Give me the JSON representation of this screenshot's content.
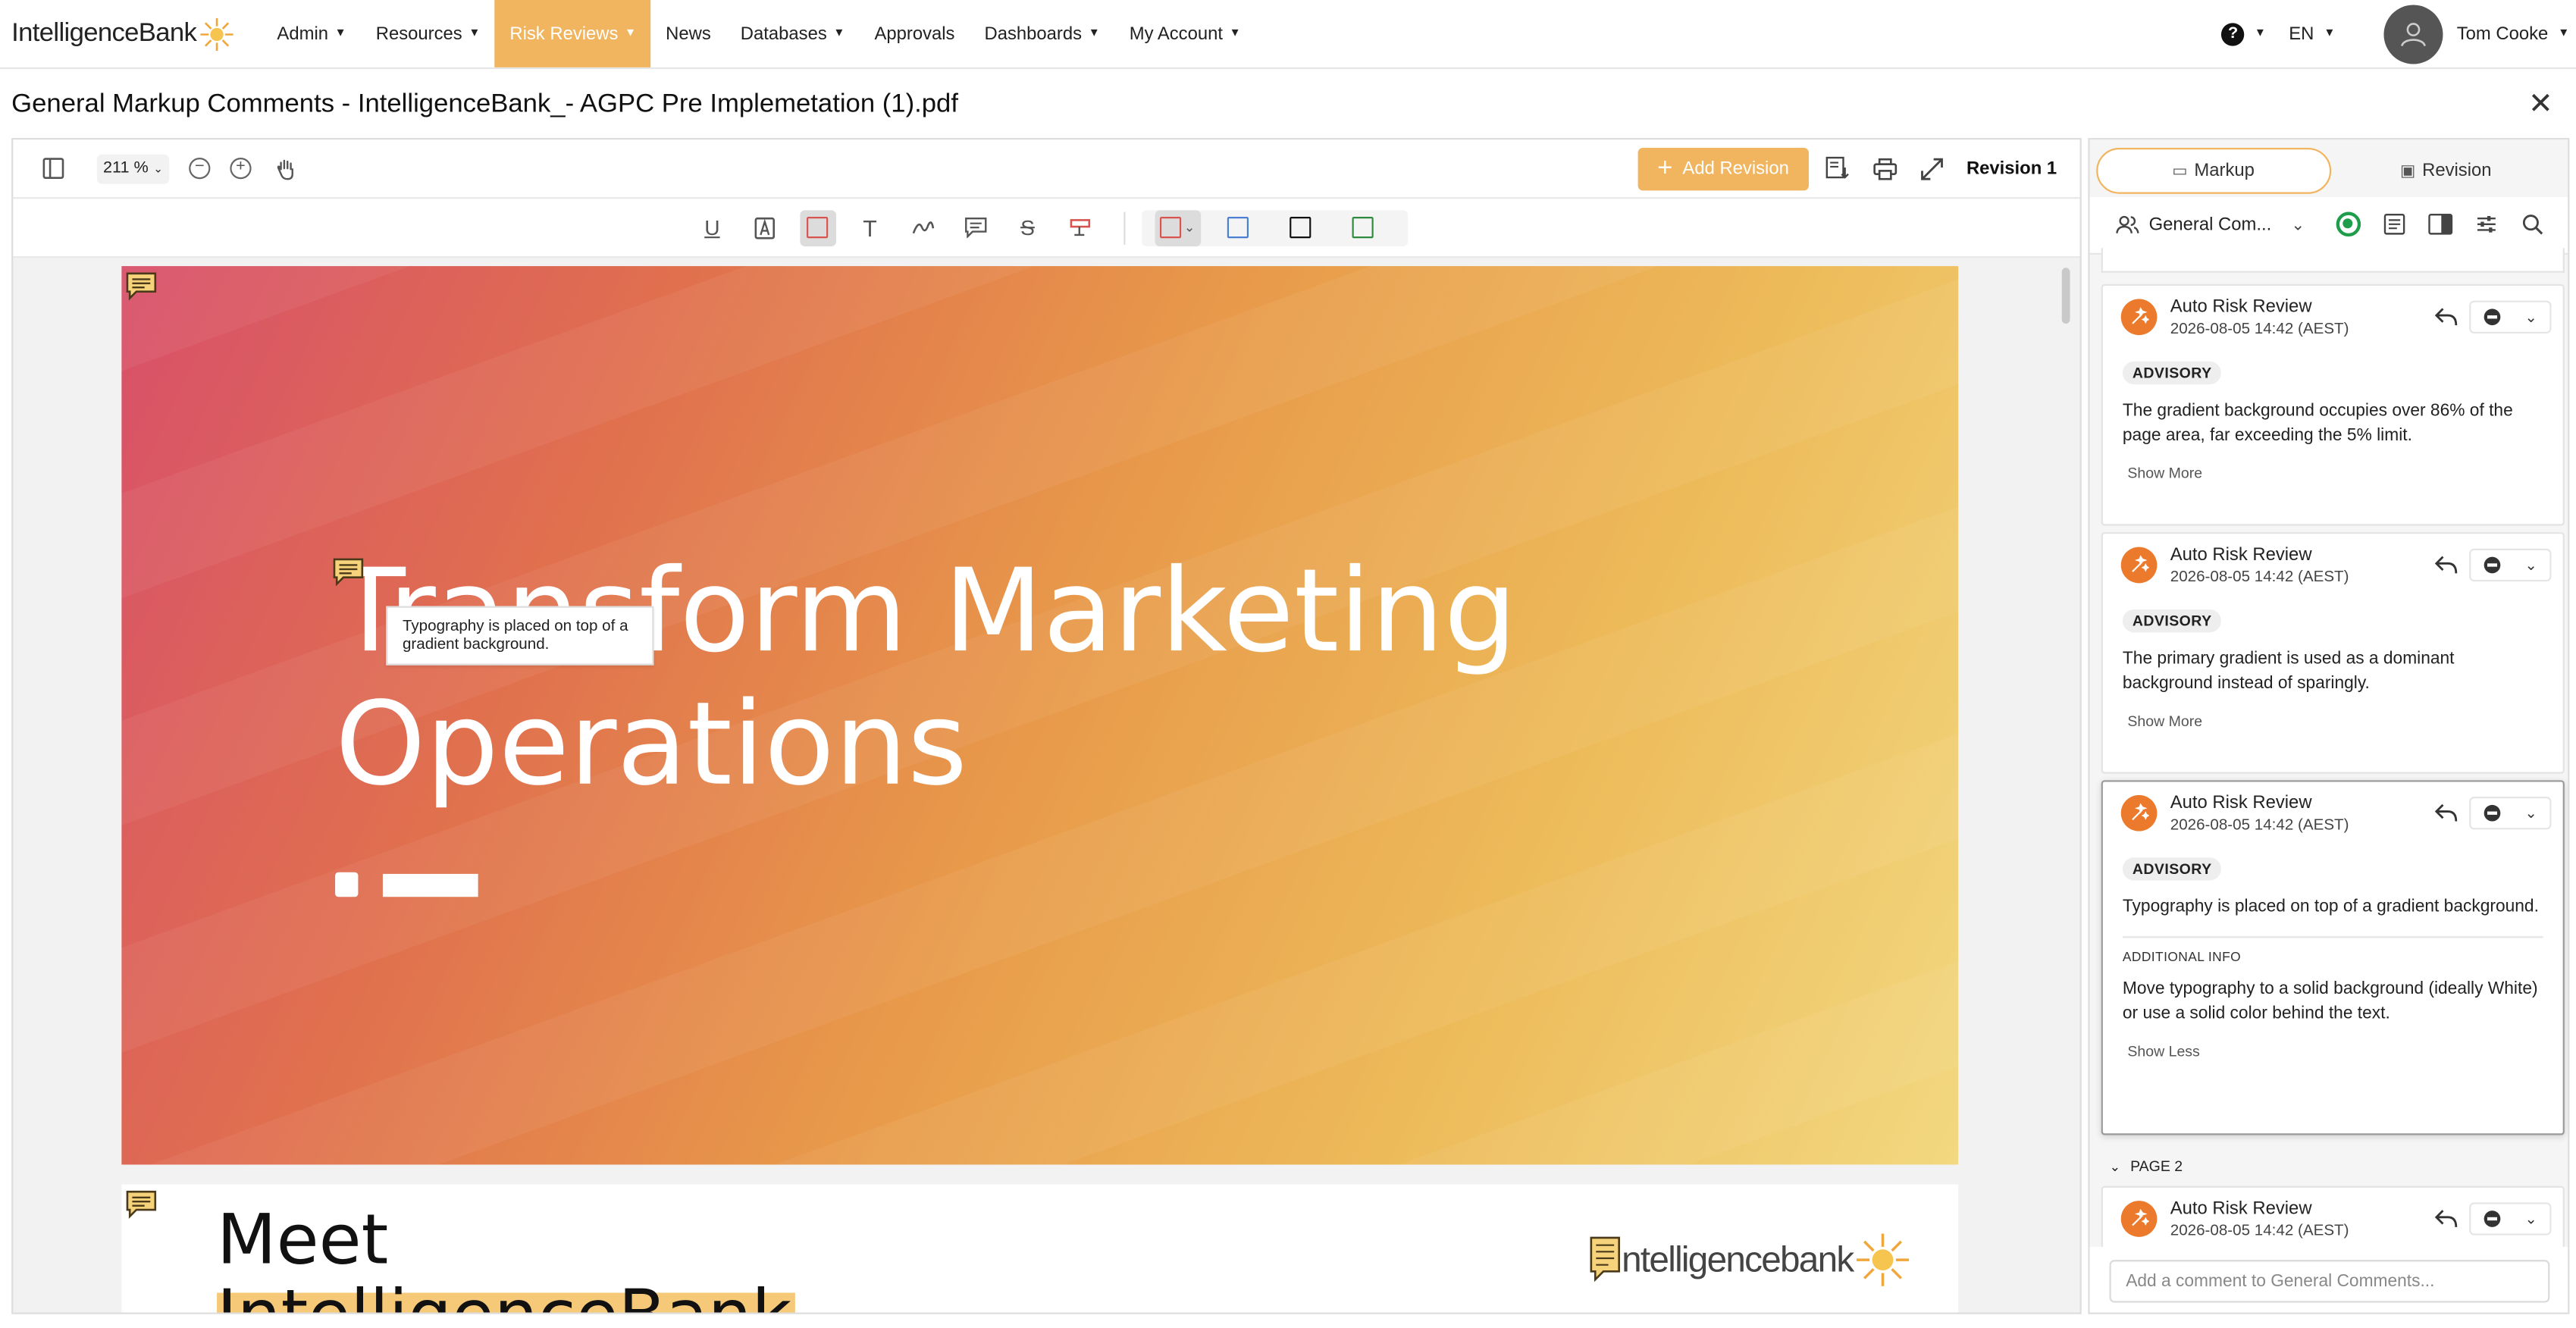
{
  "nav": {
    "logo": "IntelligenceBank",
    "items": [
      {
        "label": "Admin",
        "caret": true
      },
      {
        "label": "Resources",
        "caret": true
      },
      {
        "label": "Risk Reviews",
        "caret": true,
        "active": true
      },
      {
        "label": "News",
        "caret": false
      },
      {
        "label": "Databases",
        "caret": true
      },
      {
        "label": "Approvals",
        "caret": false
      },
      {
        "label": "Dashboards",
        "caret": true
      },
      {
        "label": "My Account",
        "caret": true
      }
    ],
    "help_icon": "?",
    "language": "EN",
    "user_name": "Tom Cooke"
  },
  "document": {
    "title": "General Markup Comments - IntelligenceBank_- AGPC Pre Implemetation (1).pdf"
  },
  "viewer": {
    "zoom": "211 %",
    "add_revision_label": "Add Revision",
    "revision_label": "Revision 1"
  },
  "page1": {
    "headline_line1": "Transform Marketing",
    "headline_line2": "Operations",
    "tooltip_text": "Typography is placed on top of a gradient background."
  },
  "page2": {
    "heading_line1": "Meet",
    "heading_line2": "IntelligenceBank",
    "logo_text": "ntelligencebank"
  },
  "panel": {
    "tabs": [
      {
        "label": "Markup",
        "active": true
      },
      {
        "label": "Revision",
        "active": false
      }
    ],
    "filter_label": "General Com...",
    "page_group_label": "PAGE 2",
    "comment_placeholder": "Add a comment to General Comments...",
    "cards": [
      {
        "reviewer": "Auto Risk Review",
        "time": "2026-08-05 14:42 (AEST)",
        "badge": "ADVISORY",
        "text": "The gradient background occupies over 86% of the page area, far exceeding the 5% limit.",
        "toggle": "Show More"
      },
      {
        "reviewer": "Auto Risk Review",
        "time": "2026-08-05 14:42 (AEST)",
        "badge": "ADVISORY",
        "text": "The primary gradient is used as a dominant background instead of sparingly.",
        "toggle": "Show More"
      },
      {
        "reviewer": "Auto Risk Review",
        "time": "2026-08-05 14:42 (AEST)",
        "badge": "ADVISORY",
        "text": "Typography is placed on top of a gradient background.",
        "additional_label": "ADDITIONAL INFO",
        "additional_text": "Move typography to a solid background (ideally White) or use a solid color behind the text.",
        "toggle": "Show Less"
      },
      {
        "reviewer": "Auto Risk Review",
        "time": "2026-08-05 14:42 (AEST)"
      }
    ]
  },
  "colors": {
    "accent": "#f0b55e",
    "status_green": "#1e9e4a",
    "robot_orange": "#ec7a2c"
  }
}
